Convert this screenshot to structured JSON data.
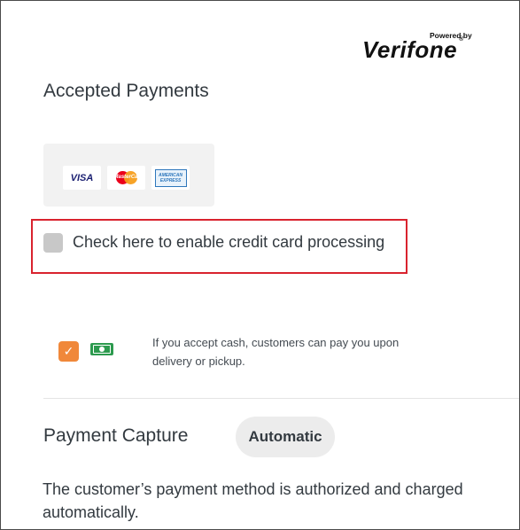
{
  "brand": {
    "powered_by": "Powered by",
    "name": "Verifone",
    "reg": "®"
  },
  "accepted_payments": {
    "title": "Accepted Payments",
    "cards": [
      {
        "name": "VISA",
        "icon": "visa-card-icon"
      },
      {
        "name": "MasterCard",
        "icon": "mastercard-card-icon"
      },
      {
        "name": "AMERICAN EXPRESS",
        "icon": "amex-card-icon"
      }
    ],
    "cc_label": "Check here to enable credit card processing",
    "cc_checked": false,
    "cash_checked": true,
    "cash_text": "If you accept cash, customers can pay you upon delivery or pickup."
  },
  "payment_capture": {
    "title": "Payment Capture",
    "mode": "Automatic",
    "description": "The customer’s payment method is authorized and charged automatically."
  },
  "colors": {
    "highlight": "#d9232e",
    "checkbox_checked": "#f0883a",
    "cash_green": "#2c9a4e"
  }
}
